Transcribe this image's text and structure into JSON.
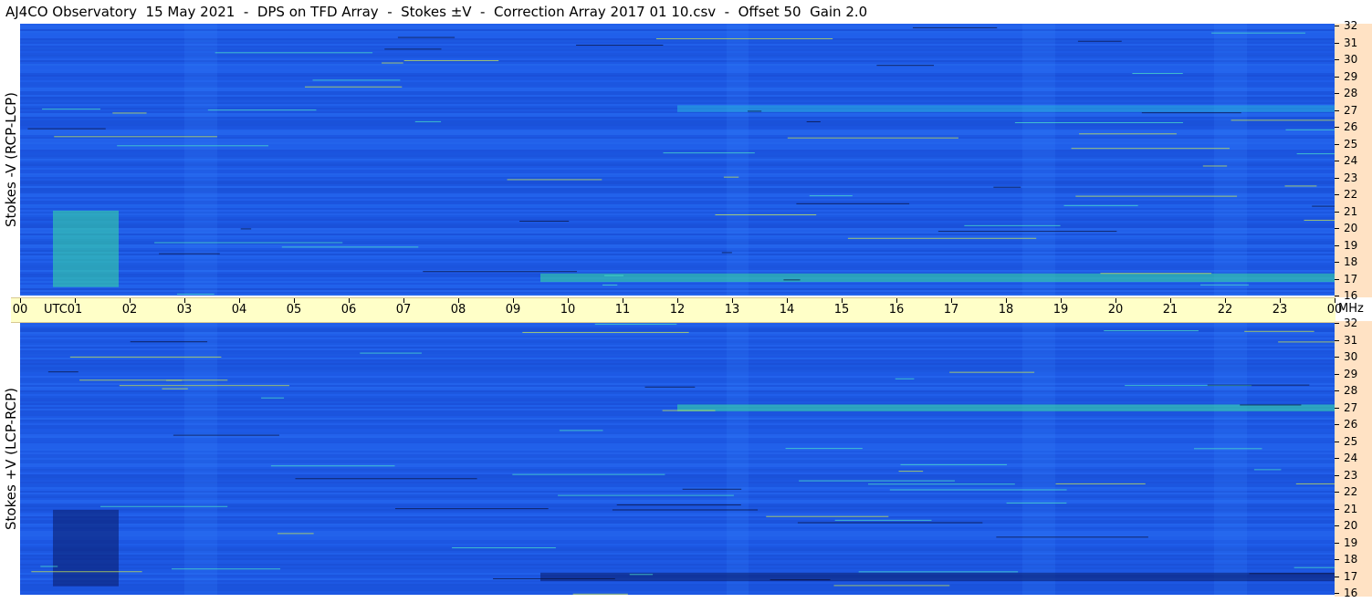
{
  "title": "AJ4CO Observatory  15 May 2021  -  DPS on TFD Array  -  Stokes ±V  -  Correction Array 2017 01 10.csv  -  Offset 50  Gain 2.0",
  "colors": {
    "background": "#1e5be8",
    "time_axis": "#ffffc8",
    "freq_axis": "#ffe2c4"
  },
  "chart_data": [
    {
      "type": "heatmap",
      "ylabel": "Stokes -V (RCP-LCP)",
      "x_ticks": [
        "00",
        "01",
        "02",
        "03",
        "04",
        "05",
        "06",
        "07",
        "08",
        "09",
        "10",
        "11",
        "12",
        "13",
        "14",
        "15",
        "16",
        "17",
        "18",
        "19",
        "20",
        "21",
        "22",
        "23",
        "00"
      ],
      "x_unit": "UTC",
      "xlim": [
        0,
        24
      ],
      "y_ticks": [
        16,
        17,
        18,
        19,
        20,
        21,
        22,
        23,
        24,
        25,
        26,
        27,
        28,
        29,
        30,
        31,
        32
      ],
      "y_unit": "MHz",
      "ylim": [
        16,
        32
      ],
      "features": [
        {
          "t_start": 0.6,
          "t_end": 1.8,
          "f_low": 16.5,
          "f_high": 21.0,
          "intensity": "high"
        },
        {
          "t_start": 9.5,
          "t_end": 24.0,
          "f_low": 16.8,
          "f_high": 17.3,
          "intensity": "high"
        },
        {
          "t_start": 12.0,
          "t_end": 24.0,
          "f_low": 26.8,
          "f_high": 27.2,
          "intensity": "medium"
        }
      ]
    },
    {
      "type": "heatmap",
      "ylabel": "Stokes +V (LCP-RCP)",
      "x_ticks": [
        "00",
        "01",
        "02",
        "03",
        "04",
        "05",
        "06",
        "07",
        "08",
        "09",
        "10",
        "11",
        "12",
        "13",
        "14",
        "15",
        "16",
        "17",
        "18",
        "19",
        "20",
        "21",
        "22",
        "23",
        "00"
      ],
      "x_unit": "UTC",
      "xlim": [
        0,
        24
      ],
      "y_ticks": [
        16,
        17,
        18,
        19,
        20,
        21,
        22,
        23,
        24,
        25,
        26,
        27,
        28,
        29,
        30,
        31,
        32
      ],
      "y_unit": "MHz",
      "ylim": [
        16,
        32
      ],
      "features": [
        {
          "t_start": 0.6,
          "t_end": 1.8,
          "f_low": 16.5,
          "f_high": 21.0,
          "intensity": "low"
        },
        {
          "t_start": 9.5,
          "t_end": 24.0,
          "f_low": 16.8,
          "f_high": 17.3,
          "intensity": "low"
        },
        {
          "t_start": 12.0,
          "t_end": 24.0,
          "f_low": 26.8,
          "f_high": 27.2,
          "intensity": "high"
        }
      ]
    }
  ]
}
